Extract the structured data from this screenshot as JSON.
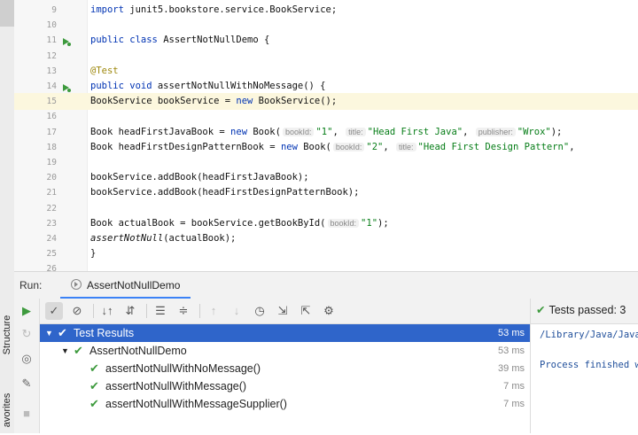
{
  "editor": {
    "lines": [
      {
        "no": "9",
        "tokens": [
          {
            "t": "import ",
            "c": "kw"
          },
          {
            "t": "junit5.bookstore.service.BookService;",
            "c": ""
          }
        ]
      },
      {
        "no": "10",
        "tokens": []
      },
      {
        "no": "11",
        "gicon": "run-class-icon",
        "tokens": [
          {
            "t": "public class ",
            "c": "kw"
          },
          {
            "t": "AssertNotNullDemo {",
            "c": ""
          }
        ]
      },
      {
        "no": "12",
        "tokens": []
      },
      {
        "no": "13",
        "tokens": [
          {
            "t": "    @Test",
            "c": "ann"
          }
        ]
      },
      {
        "no": "14",
        "gicon": "run-test-icon",
        "tokens": [
          {
            "t": "    public void ",
            "c": "kw"
          },
          {
            "t": "assertNotNullWithNoMessage() {",
            "c": ""
          }
        ]
      },
      {
        "no": "15",
        "current": true,
        "tokens": [
          {
            "t": "        BookService bookService = ",
            "c": ""
          },
          {
            "t": "new ",
            "c": "kw"
          },
          {
            "t": "BookService();",
            "c": ""
          }
        ]
      },
      {
        "no": "16",
        "tokens": []
      },
      {
        "no": "17",
        "tokens": [
          {
            "t": "        Book headFirstJavaBook = ",
            "c": ""
          },
          {
            "t": "new ",
            "c": "kw"
          },
          {
            "t": "Book(",
            "c": ""
          },
          {
            "t": "bookId:",
            "c": "hint"
          },
          {
            "t": "\"1\"",
            "c": "str"
          },
          {
            "t": ", ",
            "c": ""
          },
          {
            "t": "title:",
            "c": "hint"
          },
          {
            "t": "\"Head First Java\"",
            "c": "str"
          },
          {
            "t": ", ",
            "c": ""
          },
          {
            "t": "publisher:",
            "c": "hint"
          },
          {
            "t": "\"Wrox\"",
            "c": "str"
          },
          {
            "t": ");",
            "c": ""
          }
        ]
      },
      {
        "no": "18",
        "tokens": [
          {
            "t": "        Book headFirstDesignPatternBook = ",
            "c": ""
          },
          {
            "t": "new ",
            "c": "kw"
          },
          {
            "t": "Book(",
            "c": ""
          },
          {
            "t": "bookId:",
            "c": "hint"
          },
          {
            "t": "\"2\"",
            "c": "str"
          },
          {
            "t": ", ",
            "c": ""
          },
          {
            "t": "title:",
            "c": "hint"
          },
          {
            "t": "\"Head First Design Pattern\"",
            "c": "str"
          },
          {
            "t": ",",
            "c": ""
          }
        ]
      },
      {
        "no": "19",
        "tokens": []
      },
      {
        "no": "20",
        "tokens": [
          {
            "t": "        bookService.addBook(headFirstJavaBook);",
            "c": ""
          }
        ]
      },
      {
        "no": "21",
        "tokens": [
          {
            "t": "        bookService.addBook(headFirstDesignPatternBook);",
            "c": ""
          }
        ]
      },
      {
        "no": "22",
        "tokens": []
      },
      {
        "no": "23",
        "tokens": [
          {
            "t": "        Book actualBook = bookService.getBookById(",
            "c": ""
          },
          {
            "t": "bookId:",
            "c": "hint"
          },
          {
            "t": "\"1\"",
            "c": "str"
          },
          {
            "t": ");",
            "c": ""
          }
        ]
      },
      {
        "no": "24",
        "tokens": [
          {
            "t": "        ",
            "c": ""
          },
          {
            "t": "assertNotNull",
            "c": "it"
          },
          {
            "t": "(actualBook);",
            "c": ""
          }
        ]
      },
      {
        "no": "25",
        "tokens": [
          {
            "t": "    }",
            "c": ""
          }
        ]
      },
      {
        "no": "26",
        "tokens": []
      }
    ]
  },
  "left_strip": {
    "structure_label": "Structure",
    "favorites_label": "avorites"
  },
  "run": {
    "label": "Run:",
    "tab": "AssertNotNullDemo",
    "status_label": "Tests passed: 3",
    "output_lines": [
      "/Library/Java/Java",
      "",
      "Process finished w"
    ]
  },
  "toolbar": [
    {
      "icon": "check-icon",
      "glyph": "✓",
      "active": true
    },
    {
      "icon": "stop-circle-icon",
      "glyph": "⊘"
    },
    {
      "sep": true
    },
    {
      "icon": "sort-alpha-icon",
      "glyph": "↓↑"
    },
    {
      "icon": "sort-duration-icon",
      "glyph": "⇵"
    },
    {
      "sep": true
    },
    {
      "icon": "expand-all-icon",
      "glyph": "☰"
    },
    {
      "icon": "collapse-all-icon",
      "glyph": "≑"
    },
    {
      "sep": true
    },
    {
      "icon": "prev-failed-icon",
      "glyph": "↑",
      "disabled": true
    },
    {
      "icon": "next-failed-icon",
      "glyph": "↓",
      "disabled": true
    },
    {
      "icon": "history-icon",
      "glyph": "◷"
    },
    {
      "icon": "import-tests-icon",
      "glyph": "⇲"
    },
    {
      "icon": "export-tests-icon",
      "glyph": "⇱"
    },
    {
      "icon": "settings-gear-icon",
      "glyph": "⚙"
    }
  ],
  "tree": [
    {
      "label": "Test Results",
      "time": "53 ms",
      "depth": 0,
      "chev": "▼",
      "selected": true
    },
    {
      "label": "AssertNotNullDemo",
      "time": "53 ms",
      "depth": 1,
      "chev": "▼"
    },
    {
      "label": "assertNotNullWithNoMessage()",
      "time": "39 ms",
      "depth": 2
    },
    {
      "label": "assertNotNullWithMessage()",
      "time": "7 ms",
      "depth": 2
    },
    {
      "label": "assertNotNullWithMessageSupplier()",
      "time": "7 ms",
      "depth": 2
    }
  ],
  "colors": {
    "selection": "#2f65ca",
    "pass": "#3d9a3d",
    "keyword": "#0033b3",
    "string": "#067d17"
  }
}
